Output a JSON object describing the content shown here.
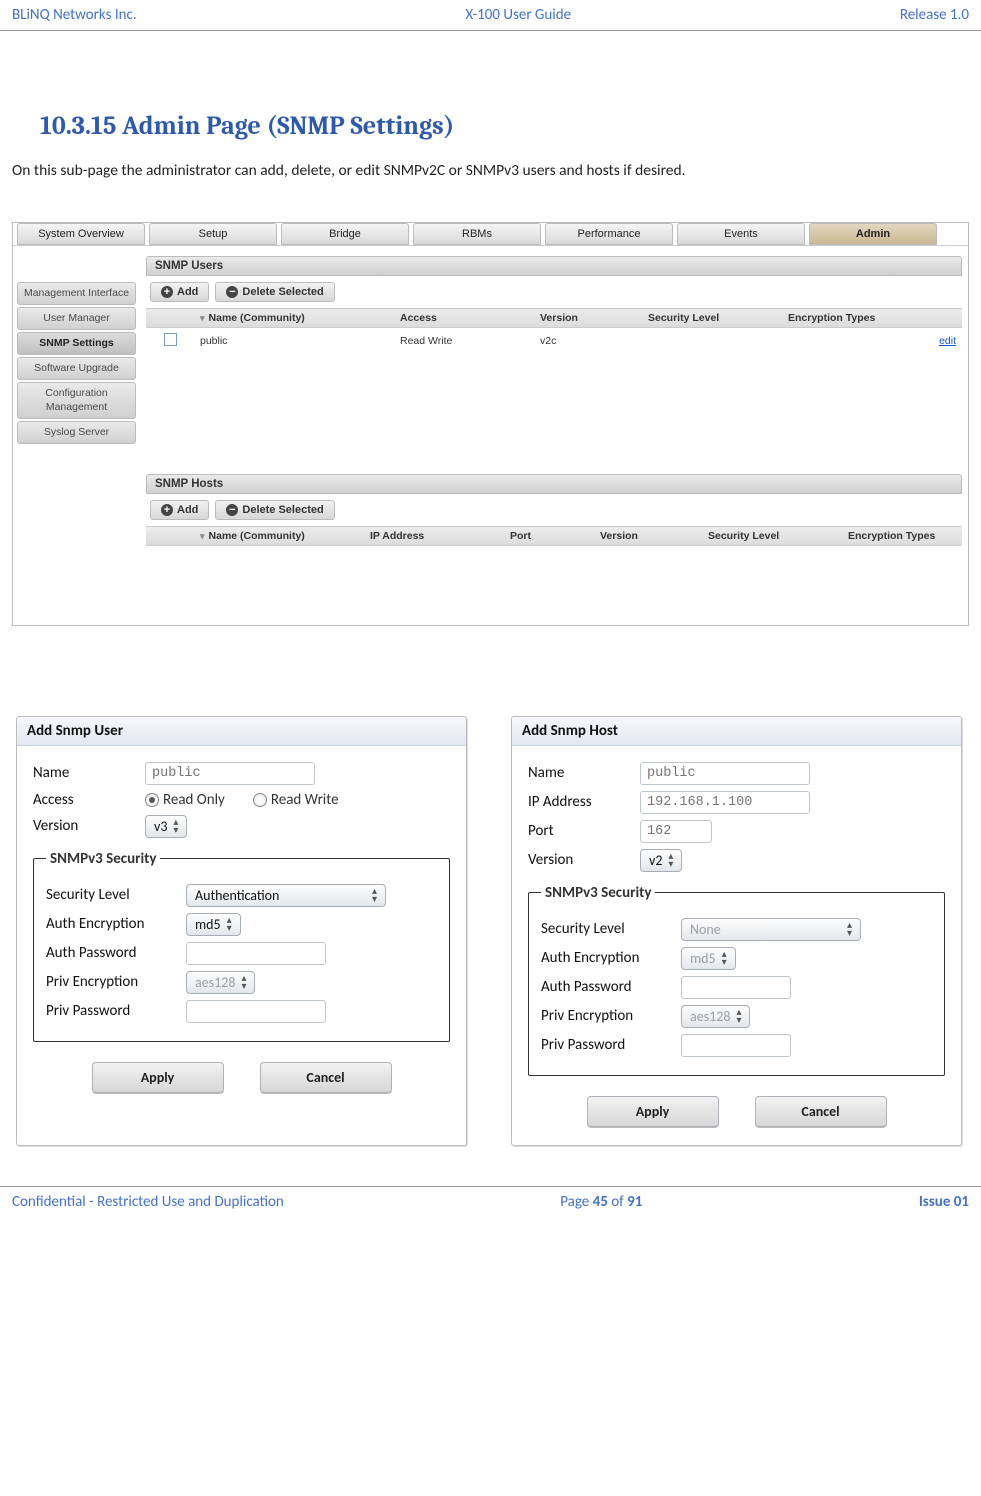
{
  "page_header": {
    "left": "BLiNQ Networks Inc.",
    "center": "X-100 User Guide",
    "right": "Release 1.0"
  },
  "section": {
    "number": "10.3.15",
    "title": "Admin Page (SNMP Settings)",
    "description": "On this sub-page the administrator can add, delete, or edit SNMPv2C or SNMPv3 users and hosts if desired."
  },
  "screenshot": {
    "tabs": [
      "System Overview",
      "Setup",
      "Bridge",
      "RBMs",
      "Performance",
      "Events",
      "Admin"
    ],
    "active_tab": "Admin",
    "sidebar": {
      "items": [
        "Management Interface",
        "User Manager",
        "SNMP Settings",
        "Software Upgrade",
        "Configuration Management",
        "Syslog Server"
      ],
      "active": "SNMP Settings"
    },
    "users_panel": {
      "title": "SNMP Users",
      "add_label": "Add",
      "delete_label": "Delete Selected",
      "columns": [
        "Name (Community)",
        "Access",
        "Version",
        "Security Level",
        "Encryption Types"
      ],
      "row": {
        "name": "public",
        "access": "Read Write",
        "version": "v2c",
        "edit": "edit"
      }
    },
    "hosts_panel": {
      "title": "SNMP Hosts",
      "add_label": "Add",
      "delete_label": "Delete Selected",
      "columns": [
        "Name (Community)",
        "IP Address",
        "Port",
        "Version",
        "Security Level",
        "Encryption Types"
      ]
    }
  },
  "dlg_user": {
    "title": "Add Snmp User",
    "fields": {
      "name_label": "Name",
      "name_placeholder": "public",
      "access_label": "Access",
      "access_opt1": "Read Only",
      "access_opt2": "Read Write",
      "version_label": "Version",
      "version_value": "v3",
      "fieldset": "SNMPv3 Security",
      "seclevel_label": "Security Level",
      "seclevel_value": "Authentication",
      "authenc_label": "Auth Encryption",
      "authenc_value": "md5",
      "authpw_label": "Auth Password",
      "privenc_label": "Priv Encryption",
      "privenc_value": "aes128",
      "privpw_label": "Priv Password"
    },
    "apply": "Apply",
    "cancel": "Cancel"
  },
  "dlg_host": {
    "title": "Add Snmp Host",
    "fields": {
      "name_label": "Name",
      "name_placeholder": "public",
      "ip_label": "IP Address",
      "ip_placeholder": "192.168.1.100",
      "port_label": "Port",
      "port_placeholder": "162",
      "version_label": "Version",
      "version_value": "v2",
      "fieldset": "SNMPv3 Security",
      "seclevel_label": "Security Level",
      "seclevel_value": "None",
      "authenc_label": "Auth Encryption",
      "authenc_value": "md5",
      "authpw_label": "Auth Password",
      "privenc_label": "Priv Encryption",
      "privenc_value": "aes128",
      "privpw_label": "Priv Password"
    },
    "apply": "Apply",
    "cancel": "Cancel"
  },
  "page_footer": {
    "left": "Confidential - Restricted Use and Duplication",
    "page_word": "Page ",
    "cur": "45",
    "of_word": " of ",
    "total": "91",
    "right": "Issue 01"
  }
}
